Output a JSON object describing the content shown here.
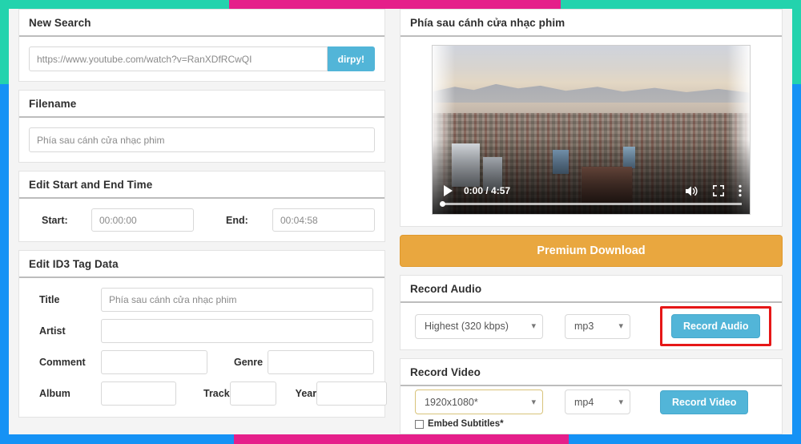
{
  "theme": {
    "teal": "#23d3ad",
    "pink": "#e51f8a",
    "blue": "#1592f5",
    "accent_button": "#52b5d8",
    "premium_button": "#e9a73f",
    "highlight_border": "#e61717",
    "resolution_select_border": "#d8c37a"
  },
  "left": {
    "new_search": {
      "header": "New Search",
      "url_value": "https://www.youtube.com/watch?v=RanXDfRCwQI",
      "submit_label": "dirpy!"
    },
    "filename": {
      "header": "Filename",
      "value": "Phía sau cánh cửa nhạc phim"
    },
    "time": {
      "header": "Edit Start and End Time",
      "start_label": "Start:",
      "start_value": "00:00:00",
      "end_label": "End:",
      "end_value": "00:04:58"
    },
    "id3": {
      "header": "Edit ID3 Tag Data",
      "title_label": "Title",
      "title_value": "Phía sau cánh cửa nhạc phim",
      "artist_label": "Artist",
      "artist_value": "",
      "comment_label": "Comment",
      "comment_value": "",
      "genre_label": "Genre",
      "genre_value": "",
      "album_label": "Album",
      "album_value": "",
      "track_label": "Track",
      "track_value": "",
      "year_label": "Year",
      "year_value": ""
    }
  },
  "right": {
    "video_panel": {
      "header": "Phía sau cánh cửa nhạc phim",
      "player": {
        "play_icon": "play-icon",
        "time_display": "0:00 / 4:57",
        "volume_icon": "volume-icon",
        "fullscreen_icon": "fullscreen-icon",
        "more_icon": "more-options-icon"
      }
    },
    "premium": {
      "label": "Premium Download"
    },
    "record_audio": {
      "header": "Record Audio",
      "quality_value": "Highest (320 kbps)",
      "format_value": "mp3",
      "button_label": "Record Audio"
    },
    "record_video": {
      "header": "Record Video",
      "resolution_value": "1920x1080*",
      "format_value": "mp4",
      "button_label": "Record Video",
      "subtitles_label": "Embed Subtitles*"
    }
  }
}
